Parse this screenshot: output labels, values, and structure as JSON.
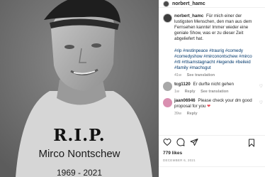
{
  "post": {
    "rip": "R.I.P.",
    "name": "Mirco Nontschew",
    "years": "1969 - 2021"
  },
  "header": {
    "username": "norbert_hamc"
  },
  "caption": {
    "username": "norbert_hamc",
    "text": "Für mich einer der lustigsten Menschen, den man aus dem Fernsehen kannte! Immer wieder eine geniale Show, was er zu dieser Zeit abgeliefert hat.",
    "hashtags": "#rip #restinpeace #traurig #comedy #comedyshow #mirconontschew #mirco #rtl #rtlsamstagnacht #legende #beileid #family #machsgut",
    "time": "41w",
    "see_translation": "See translation"
  },
  "comments": [
    {
      "username": "tcg1120",
      "text": "Er durfte nicht gehen",
      "time": "1w",
      "reply": "Reply",
      "see_translation": "See translation"
    },
    {
      "username": "jaan06946",
      "text": "Please check your dm good proposal for you",
      "time": "39w",
      "reply": "Reply"
    }
  ],
  "likes": "779 likes",
  "date": "DECEMBER 6, 2021",
  "icons": {
    "like": "heart-icon",
    "comment": "comment-icon",
    "share": "send-icon",
    "save": "bookmark-icon",
    "heart_emoji": "red-heart-icon"
  },
  "colors": {
    "link": "#00376b",
    "muted": "#8e8e8e",
    "heart": "#ed4956"
  }
}
